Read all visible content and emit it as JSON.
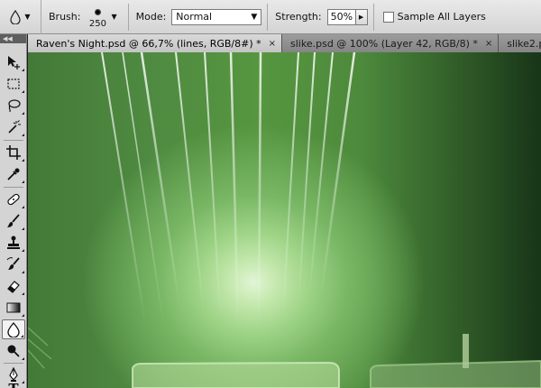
{
  "options_bar": {
    "brush_label": "Brush:",
    "brush_size": "250",
    "mode_label": "Mode:",
    "mode_value": "Normal",
    "strength_label": "Strength:",
    "strength_value": "50%",
    "sample_all_layers_label": "Sample All Layers",
    "sample_all_layers_checked": false
  },
  "tabs": [
    {
      "label": "Raven's Night.psd @ 66,7% (lines, RGB/8#) *",
      "active": true
    },
    {
      "label": "slike.psd @ 100% (Layer 42, RGB/8) *",
      "active": false
    },
    {
      "label": "slike2.psd @ 1",
      "active": false
    }
  ],
  "tab_close_glyph": "×",
  "toolbox": {
    "tools": [
      {
        "name": "move-tool"
      },
      {
        "name": "marquee-tool"
      },
      {
        "name": "lasso-tool"
      },
      {
        "name": "magic-wand-tool"
      },
      {
        "name": "crop-tool"
      },
      {
        "name": "eyedropper-tool"
      },
      {
        "name": "healing-brush-tool"
      },
      {
        "name": "brush-tool"
      },
      {
        "name": "clone-stamp-tool"
      },
      {
        "name": "history-brush-tool"
      },
      {
        "name": "eraser-tool"
      },
      {
        "name": "gradient-tool"
      },
      {
        "name": "blur-tool",
        "active": true
      },
      {
        "name": "dodge-tool"
      },
      {
        "name": "pen-tool"
      },
      {
        "name": "type-tool",
        "glyph": "T"
      }
    ]
  },
  "colors": {
    "ui_gray": "#d4d4d4",
    "tab_bar": "#6d6d6d",
    "canvas_glow": "#e2f5d6",
    "canvas_green": "#56963f",
    "canvas_dark": "#183518"
  }
}
